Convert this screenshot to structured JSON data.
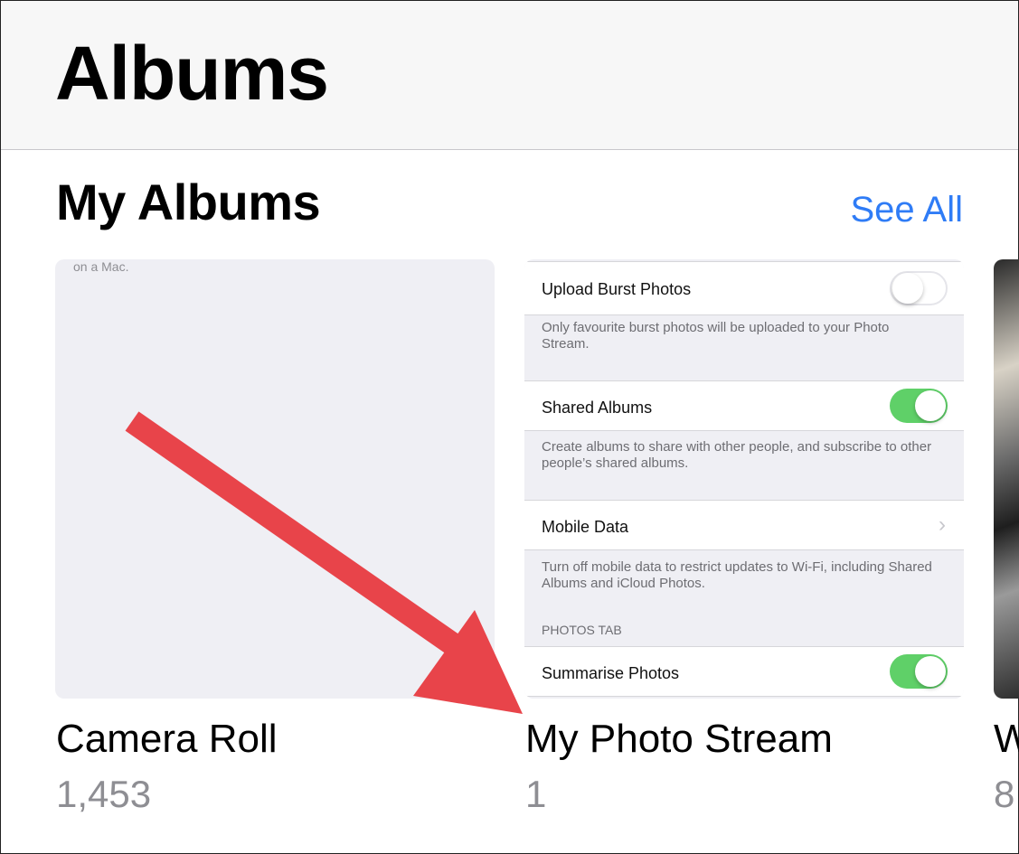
{
  "header": {
    "title": "Albums"
  },
  "section": {
    "title": "My Albums",
    "see_all": "See All"
  },
  "albums": [
    {
      "name": "Camera Roll",
      "count": "1,453",
      "thumb_text": "on a Mac."
    },
    {
      "name": "My Photo Stream",
      "count": "1"
    },
    {
      "name": "W",
      "count": "8"
    }
  ],
  "settings_preview": {
    "upload_burst": {
      "label": "Upload Burst Photos",
      "on": false,
      "desc": "Only favourite burst photos will be uploaded to your Photo Stream."
    },
    "shared_albums": {
      "label": "Shared Albums",
      "on": true,
      "desc": "Create albums to share with other people, and subscribe to other people’s shared albums."
    },
    "mobile_data": {
      "label": "Mobile Data",
      "desc": "Turn off mobile data to restrict updates to Wi-Fi, including Shared Albums and iCloud Photos."
    },
    "photos_tab_header": "PHOTOS TAB",
    "summarise": {
      "label": "Summarise Photos",
      "on": true
    }
  },
  "colors": {
    "accent": "#2f7cf6",
    "arrow": "#e8444a",
    "toggle_on": "#5fd068"
  }
}
